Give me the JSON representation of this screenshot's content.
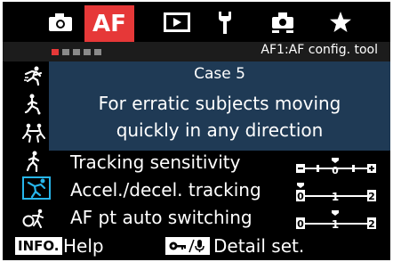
{
  "tabs": [
    {
      "icon": "camera-icon"
    },
    {
      "label": "AF",
      "active": true
    },
    {
      "icon": "playback-icon"
    },
    {
      "icon": "wrench-icon"
    },
    {
      "icon": "custom-function-icon"
    },
    {
      "icon": "star-icon"
    }
  ],
  "menu_title": "AF1:AF config. tool",
  "page_indicator": {
    "total": 5,
    "active": 1
  },
  "case": {
    "title": "Case 5",
    "description_line1": "For erratic subjects moving",
    "description_line2": "quickly in any direction"
  },
  "side_icons": [
    "case1-icon",
    "case2-icon",
    "case3-icon",
    "case4-icon",
    "case5-icon",
    "case6-icon"
  ],
  "selected_case": 5,
  "settings": [
    {
      "label": "Tracking sensitivity",
      "scale": [
        "−",
        "0",
        "+"
      ],
      "value": 0
    },
    {
      "label": "Accel./decel. tracking",
      "scale": [
        "0",
        "1",
        "2"
      ],
      "value": 0
    },
    {
      "label": "AF pt auto switching",
      "scale": [
        "0",
        "1",
        "2"
      ],
      "value": 1
    }
  ],
  "footer": {
    "info_key": "INFO.",
    "help_label": "Help",
    "lock_key_icon": "key-mic-icon",
    "detail_label": "Detail set."
  },
  "colors": {
    "accent": "#e63838",
    "selection": "#27b6ec",
    "case_background": "#1f3a55"
  }
}
